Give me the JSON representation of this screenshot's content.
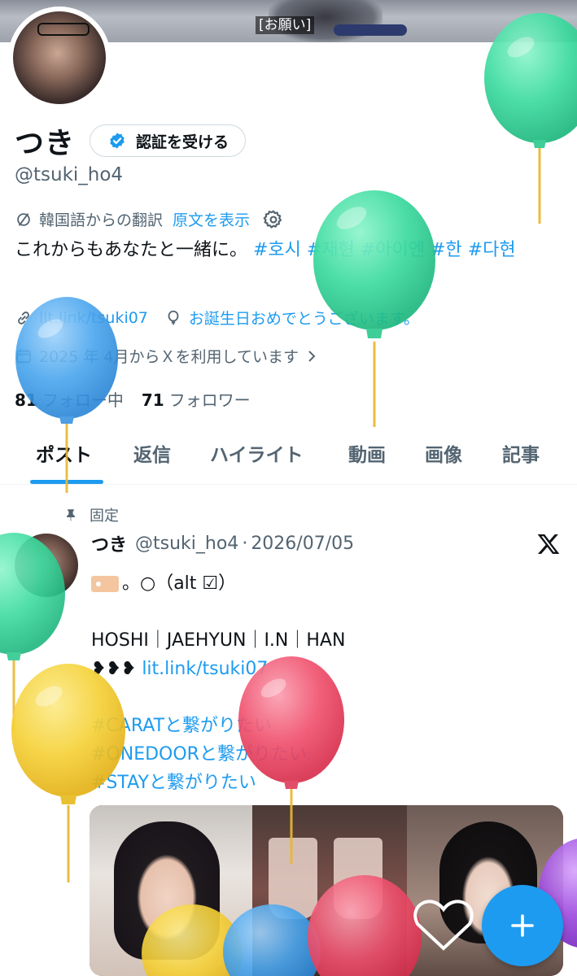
{
  "banner": {
    "caption": "[お願い]"
  },
  "profile": {
    "display_name": "つき",
    "verify_button": "認証を受ける",
    "handle": "@tsuki_ho4",
    "translation_note": "韓国語からの翻訳",
    "show_original": "原文を表示",
    "bio_text": "これからもあなたと一緒に。 ",
    "bio_tags": [
      "#호시",
      "#재현",
      "#아이엔",
      "#한",
      "#다현"
    ],
    "link": "lit.link/tsuki07",
    "birthday": "お誕生日おめでとうございます。",
    "joined": "2025 年 4月からＸを利用しています",
    "following_count": "81",
    "following_label": "フォロー中",
    "followers_count": "71",
    "followers_label": "フォロワー"
  },
  "tabs": [
    "ポスト",
    "返信",
    "ハイライト",
    "動画",
    "画像",
    "記事"
  ],
  "active_tab": "ポスト",
  "pinned_post": {
    "pinned_label": "固定",
    "author": "つき",
    "handle": "@tsuki_ho4",
    "separator": "·",
    "date": "2026/07/05",
    "line1_suffix": "。○（alt ☑）",
    "line2": "HOSHI｜JAEHYUN｜I.N｜HAN",
    "line3_prefix": "❥❥❥",
    "line3_link": "lit.link/tsuki07",
    "tags": [
      "#CARATと繋がりたい",
      "#ONEDOORと繋がりたい",
      "#STAYと繋がりたい"
    ]
  },
  "icons": {
    "verified": "verified-badge-icon",
    "translate": "translate-icon",
    "settings": "gear-icon",
    "link": "link-icon",
    "birthday": "balloon-icon",
    "calendar": "calendar-icon",
    "pin": "pin-icon",
    "x_logo": "x-logo-icon",
    "compose": "plus-icon"
  },
  "colors": {
    "accent": "#1d9bf0",
    "text_primary": "#0f1419",
    "text_secondary": "#536471",
    "balloon_green": "#3ddba0",
    "balloon_blue": "#4aa6ee",
    "balloon_yellow": "#f6d23a",
    "balloon_pink": "#f0526e",
    "balloon_purple": "#a04ee0"
  }
}
